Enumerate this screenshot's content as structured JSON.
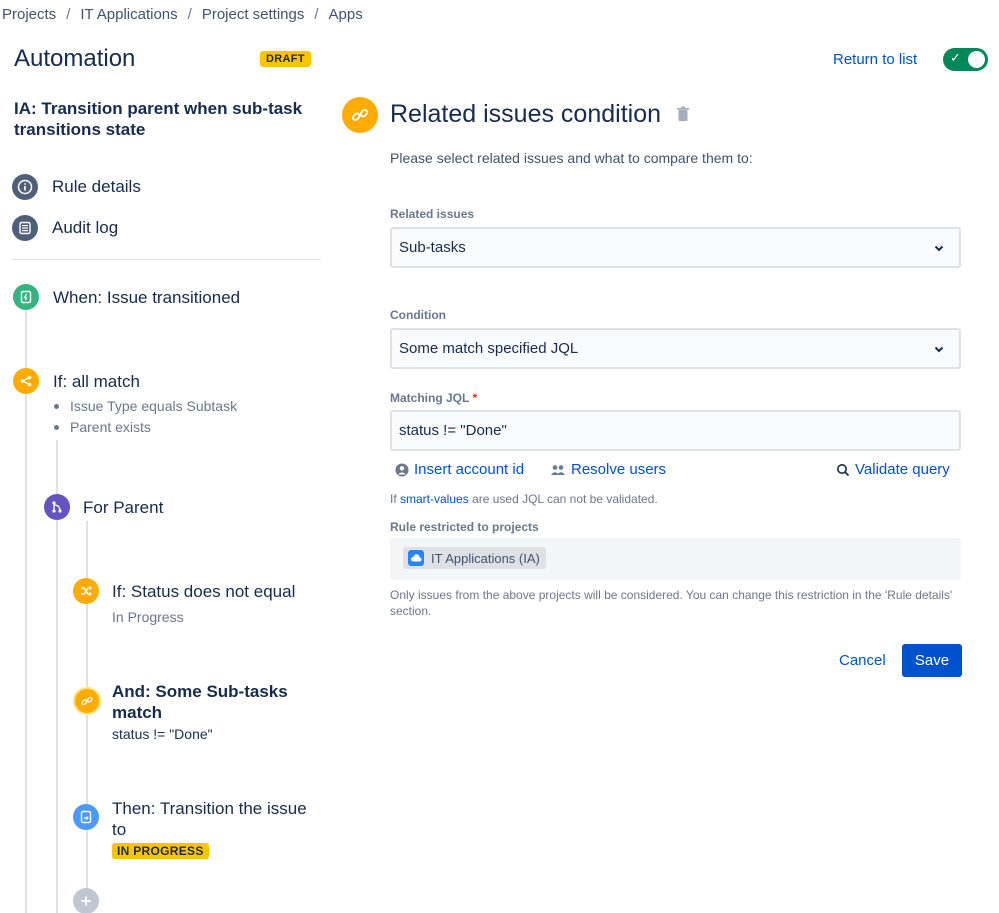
{
  "breadcrumb": [
    "Projects",
    "IT Applications",
    "Project settings",
    "Apps"
  ],
  "breadcrumb_separator": "/",
  "header": {
    "title": "Automation",
    "draft_badge": "DRAFT",
    "return_link": "Return to list",
    "toggle_enabled": true
  },
  "rule": {
    "name": "IA: Transition parent when sub-task transitions state"
  },
  "nav": {
    "rule_details": "Rule details",
    "audit_log": "Audit log"
  },
  "steps": {
    "trigger": {
      "label": "When: Issue transitioned"
    },
    "if_all": {
      "label": "If: all match",
      "conditions": [
        "Issue Type equals Subtask",
        "Parent exists"
      ]
    },
    "for_parent": {
      "label": "For Parent"
    },
    "if_status": {
      "label": "If: Status does not equal",
      "sub": "In Progress"
    },
    "and_some": {
      "label": "And: Some Sub-tasks match",
      "sub": "status != \"Done\""
    },
    "then_transition": {
      "label": "Then: Transition the issue to",
      "status": "IN PROGRESS"
    }
  },
  "panel": {
    "title": "Related issues condition",
    "description": "Please select related issues and what to compare them to:",
    "related_label": "Related issues",
    "related_value": "Sub-tasks",
    "condition_label": "Condition",
    "condition_value": "Some match specified JQL",
    "jql_label": "Matching JQL",
    "jql_required": "*",
    "jql_value": "status != \"Done\"",
    "insert_account": "Insert account id",
    "resolve_users": "Resolve users",
    "validate_query": "Validate query",
    "hint_prefix": "If ",
    "hint_link": "smart-values",
    "hint_suffix": " are used JQL can not be validated.",
    "restricted_label": "Rule restricted to projects",
    "project_tag": "IT Applications (IA)",
    "restrict_note": "Only issues from the above projects will be considered. You can change this restriction in the 'Rule details' section.",
    "cancel": "Cancel",
    "save": "Save"
  },
  "colors": {
    "accent": "#0052cc",
    "toggle_on": "#00875a",
    "trigger": "#36b37e",
    "condition": "#ffab00",
    "branch": "#6554c0",
    "action": "#4c9aff",
    "lozenge": "#ffc400"
  },
  "icons": {
    "rule_details": "info-icon",
    "audit_log": "list-icon",
    "trigger": "lightning-icon",
    "if_all": "branch-condition-icon",
    "for_parent": "branch-icon",
    "if_status": "shuffle-icon",
    "and_some": "link-icon",
    "then_transition": "transition-icon",
    "add": "plus-icon"
  }
}
